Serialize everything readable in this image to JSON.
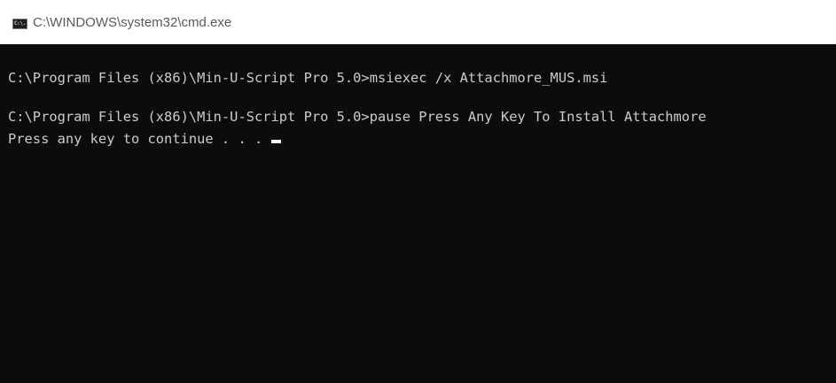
{
  "window": {
    "title": "C:\\WINDOWS\\system32\\cmd.exe",
    "icon": {
      "name": "cmd-icon",
      "text": "C:\\."
    }
  },
  "console": {
    "lines": [
      "C:\\Program Files (x86)\\Min-U-Script Pro 5.0>msiexec /x Attachmore_MUS.msi",
      "C:\\Program Files (x86)\\Min-U-Script Pro 5.0>pause Press Any Key To Install Attachmore",
      "Press any key to continue . . . "
    ]
  },
  "colors": {
    "console_background": "#0c0c0c",
    "console_text": "#cccccc",
    "titlebar_background": "#ffffff",
    "title_text": "#5a5a5a"
  }
}
